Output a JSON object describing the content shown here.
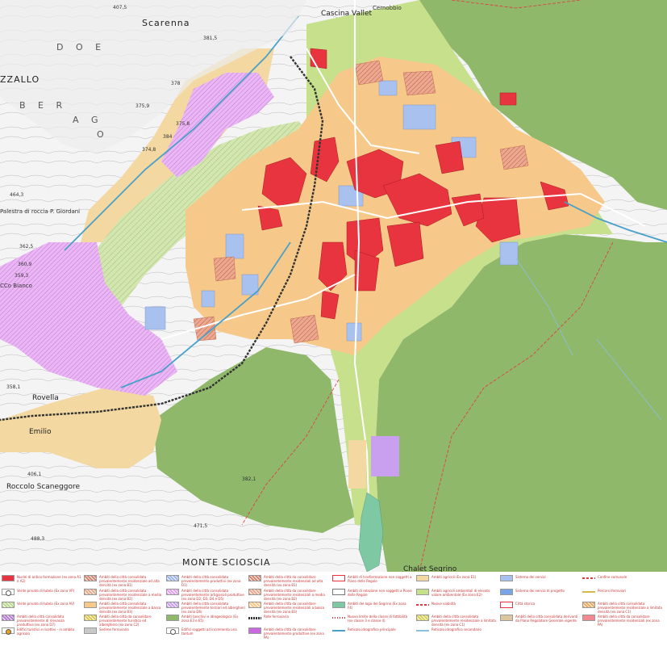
{
  "map": {
    "places": [
      {
        "name": "Scarenna",
        "cls": "big"
      },
      {
        "name": "Cascina Vallet",
        "cls": "med"
      },
      {
        "name": "Cernobbio",
        "cls": "small"
      },
      {
        "name": "D O E",
        "cls": "spaced"
      },
      {
        "name": "ZZALLO",
        "cls": "big"
      },
      {
        "name": "B E R",
        "cls": "spaced"
      },
      {
        "name": "A G",
        "cls": "spaced"
      },
      {
        "name": "O",
        "cls": "spaced"
      },
      {
        "name": "Palestra di roccia  P. Giordani",
        "cls": "small"
      },
      {
        "name": "CCo Bianco",
        "cls": "small"
      },
      {
        "name": "Rovella",
        "cls": "med"
      },
      {
        "name": "Emilio",
        "cls": "med"
      },
      {
        "name": "Roccolo Scaneggore",
        "cls": "med"
      },
      {
        "name": "MONTE SCIOSCIA",
        "cls": "big"
      },
      {
        "name": "Chalet Segrino",
        "cls": "med"
      }
    ],
    "elevations": [
      "407,5",
      "381,5",
      "375,9",
      "375,8",
      "384",
      "374,8",
      "378",
      "464,3",
      "362,5",
      "360,9",
      "359,3",
      "358,1",
      "406,1",
      "488,3",
      "471,5",
      "382,1"
    ]
  },
  "legend": {
    "items": [
      {
        "label": "Nuclei di antica formazione (ex zona A1 e A2)",
        "color": "#e8343f",
        "pattern": "solid"
      },
      {
        "label": "Ambiti della città consolidata prevalentemente residenziale ad alta densità (ex zona B1)",
        "color": "#d9846e",
        "pattern": "hatch"
      },
      {
        "label": "Ambiti della città consolidata prevalentemente produttivi (ex zona D1)",
        "color": "#9ab4e8",
        "pattern": "hatch"
      },
      {
        "label": "Ambiti della città da consolidare prevalentemente residenziali ad alta densità (ex zona B1)",
        "color": "#d9846e",
        "pattern": "hatch"
      },
      {
        "label": "Ambiti di trasformazione non soggetti a Piano delle Regole",
        "color": "#ffffff",
        "pattern": "outline-red"
      },
      {
        "label": "Ambiti agricoli (Ex zona E1)",
        "color": "#f3d9a1",
        "pattern": "solid"
      },
      {
        "label": "Sistema dei servizi",
        "color": "#a9c1ef",
        "pattern": "solid"
      },
      {
        "label": "Confine comunale",
        "color": "#e8343f",
        "pattern": "dash"
      },
      {
        "label": "Verde privato di tutela (Ex zona VP)",
        "color": "#ffffff",
        "pattern": "icon"
      },
      {
        "label": "Ambiti della città consolidata prevalentemente residenziale a media densità (ex zona B2)",
        "color": "#e9a98d",
        "pattern": "hatch"
      },
      {
        "label": "Ambiti della città consolidata prevalentemente artigianali produttive (ex zona D2, D3, D4 e D5)",
        "color": "#e3a0ef",
        "pattern": "hatch"
      },
      {
        "label": "Ambiti della città da consolidare prevalentemente residenziali a media densità (ex zona B2)",
        "color": "#e9a98d",
        "pattern": "hatch"
      },
      {
        "label": "Ambiti di relazione non soggetti a Piano delle Regole",
        "color": "#ffffff",
        "pattern": "outline-grey"
      },
      {
        "label": "Ambiti agricoli ambientali di elevato valore ambientale (Ex zona E2)",
        "color": "#c6e08c",
        "pattern": "solid"
      },
      {
        "label": "Sistema dei servizi di progetto",
        "color": "#7aa4e6",
        "pattern": "solid"
      },
      {
        "label": "Percorsi ferroviari",
        "color": "#d9b84a",
        "pattern": "line"
      },
      {
        "label": "Verde privato di tutela (Ex zona AV)",
        "color": "#b8d98c",
        "pattern": "hatch"
      },
      {
        "label": "Ambiti della città consolidata prevalentemente residenziale a bassa densità (ex zona B3)",
        "color": "#f6c98a",
        "pattern": "solid"
      },
      {
        "label": "Ambiti della città consolidata prevalentemente terziari ed alberghieri (ex zona D6)",
        "color": "#c9a0ef",
        "pattern": "hatch"
      },
      {
        "label": "Ambiti della città da consolidare prevalentemente residenziali a bassa densità (ex zona B3)",
        "color": "#f6c98a",
        "pattern": "hatch"
      },
      {
        "label": "Ambiti del lago del Segrino (Ex zona F4)",
        "color": "#7fc8a4",
        "pattern": "solid"
      },
      {
        "label": "Nuove viabilità",
        "color": "#e8343f",
        "pattern": "dash"
      },
      {
        "label": "Cittá storica",
        "color": "#ffffff",
        "pattern": "outline-red"
      },
      {
        "label": "Ambiti della città consolidata prevalentemente residenziale a limitata densità (ex zona C1)",
        "color": "#f0a860",
        "pattern": "hatch"
      },
      {
        "label": "Ambiti della città consolidata prevalentemente di rilevanza produttiva (ex zona D7)",
        "color": "#b478d8",
        "pattern": "hatch"
      },
      {
        "label": "Ambiti della città da consolidare prevalentemente turistico ed alberghiero (ex zona C2)",
        "color": "#e0c84a",
        "pattern": "hatch"
      },
      {
        "label": "Ambiti boschivi e idrogeologica (Ex zona E3 e E5)",
        "color": "#8fb86a",
        "pattern": "solid"
      },
      {
        "label": "Rete ferroviaria",
        "color": "#444444",
        "pattern": "rail"
      },
      {
        "label": "Nuovo limite della classe di fattibilità (ex classe 3 e classe 4)",
        "color": "#e8343f",
        "pattern": "dot"
      },
      {
        "label": "Ambiti della città consolidata prevalentemente residenziale a limitata densità (ex zona C1)",
        "color": "#d8d050",
        "pattern": "hatch"
      },
      {
        "label": "Ambiti della città consolidata derivanti da Piano Regolatore Generale vigente",
        "color": "#dcc6a0",
        "pattern": "solid"
      },
      {
        "label": "Ambiti della città da consolidare prevalentemente residenziali (ex zona PA)",
        "color": "#f28890",
        "pattern": "solid"
      },
      {
        "label": "Edifici turistici e ricettivi - in ambito agricolo",
        "color": "#f0a020",
        "pattern": "icon"
      },
      {
        "label": "Sedime ferroviario",
        "color": "#c8c8c8",
        "pattern": "solid"
      },
      {
        "label": "Edifici soggetti ad incremento una tantum",
        "color": "#ffffff",
        "pattern": "icon"
      },
      {
        "label": "Ambiti della città da consolidare prevalentemente produttive (ex zona PA)",
        "color": "#c86ae0",
        "pattern": "solid"
      },
      {
        "label": "Reticolo idrografico principale",
        "color": "#4aa0c8",
        "pattern": "line"
      },
      {
        "label": "Reticolo idrografico secondario",
        "color": "#8ac0e0",
        "pattern": "line"
      }
    ]
  }
}
